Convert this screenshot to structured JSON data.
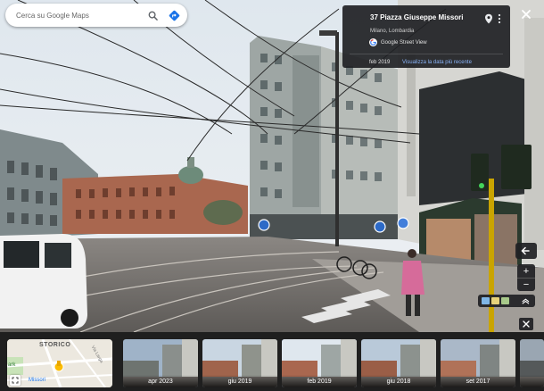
{
  "search": {
    "placeholder": "Cerca su Google Maps"
  },
  "card": {
    "title": "37 Piazza Giuseppe Missori",
    "subtitle": "Milano, Lombardia",
    "provider": "Google Street View",
    "date": "feb 2019",
    "recent_link": "Visualizza la data più recente"
  },
  "minimap": {
    "label": "STORICO",
    "park_label": "ark",
    "place_label": "Missori",
    "street_label": "Via Larga"
  },
  "timeline": [
    {
      "label": "apr 2023",
      "selected": false
    },
    {
      "label": "giu 2019",
      "selected": false
    },
    {
      "label": "feb 2019",
      "selected": true
    },
    {
      "label": "giu 2018",
      "selected": false
    },
    {
      "label": "set 2017",
      "selected": false
    },
    {
      "label": "",
      "selected": false
    }
  ],
  "controls": {
    "zoom_in": "+",
    "zoom_out": "−"
  },
  "colors": {
    "accent": "#8ab4f8",
    "panel": "#202124",
    "directions": "#1a73e8"
  },
  "icons": [
    "search-icon",
    "directions-icon",
    "pin-icon",
    "more-vert-icon",
    "close-icon",
    "expand-icon",
    "layers-icon",
    "back-arrow-icon"
  ]
}
